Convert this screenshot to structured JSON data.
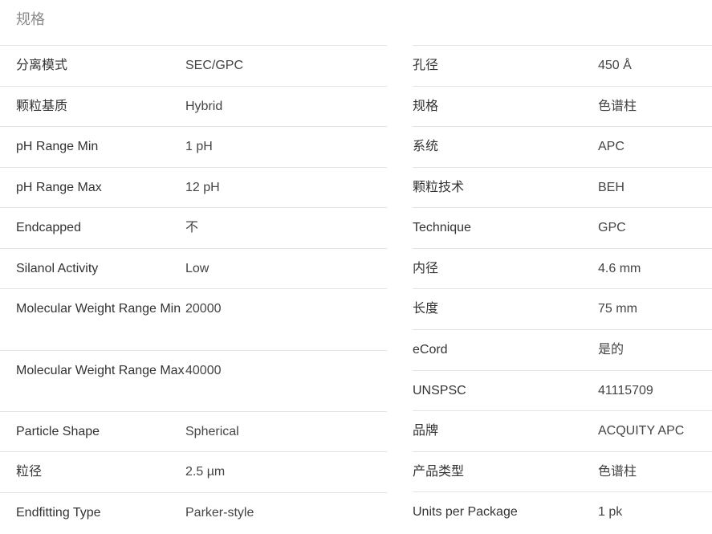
{
  "section": {
    "title": "规格"
  },
  "left_rows": [
    {
      "key": "分离模式",
      "value": "SEC/GPC"
    },
    {
      "key": "颗粒基质",
      "value": "Hybrid"
    },
    {
      "key": "pH Range Min",
      "value": "1 pH"
    },
    {
      "key": "pH Range Max",
      "value": "12 pH"
    },
    {
      "key": "Endcapped",
      "value": "不"
    },
    {
      "key": "Silanol Activity",
      "value": "Low"
    },
    {
      "key": "Molecular Weight Range Min",
      "value": "20000"
    },
    {
      "key": "Molecular Weight Range Max",
      "value": "40000"
    },
    {
      "key": "Particle Shape",
      "value": "Spherical"
    },
    {
      "key": "粒径",
      "value": "2.5 µm"
    },
    {
      "key": "Endfitting Type",
      "value": "Parker-style"
    }
  ],
  "right_rows": [
    {
      "key": "孔径",
      "value": "450 Å"
    },
    {
      "key": "规格",
      "value": "色谱柱"
    },
    {
      "key": "系统",
      "value": "APC"
    },
    {
      "key": "颗粒技术",
      "value": "BEH"
    },
    {
      "key": "Technique",
      "value": "GPC"
    },
    {
      "key": "内径",
      "value": "4.6 mm"
    },
    {
      "key": "长度",
      "value": "75 mm"
    },
    {
      "key": "eCord",
      "value": "是的"
    },
    {
      "key": "UNSPSC",
      "value": "41115709"
    },
    {
      "key": "品牌",
      "value": "ACQUITY APC"
    },
    {
      "key": "产品类型",
      "value": "色谱柱"
    },
    {
      "key": "Units per Package",
      "value": "1 pk"
    }
  ]
}
